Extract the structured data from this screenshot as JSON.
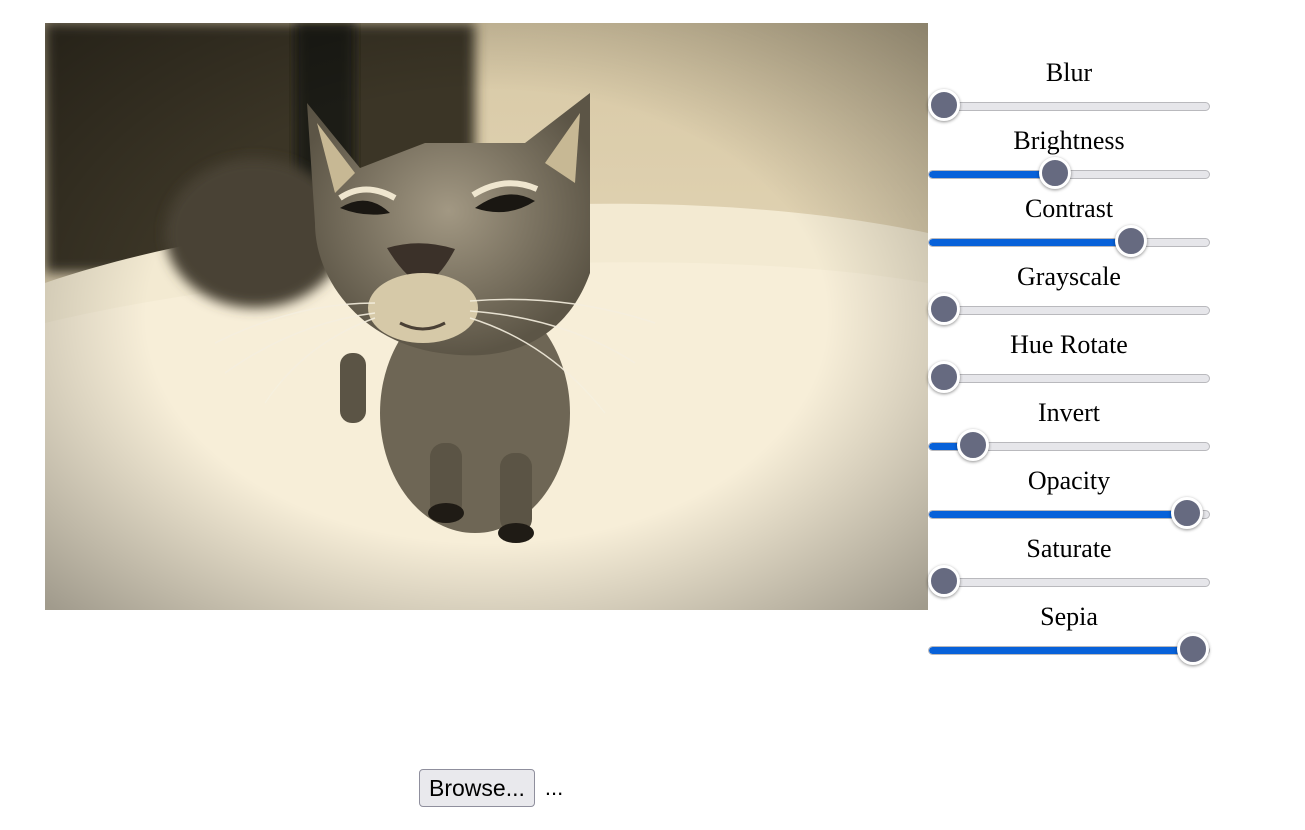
{
  "preview": {
    "image": "sepia-toned-cat-photo"
  },
  "filters": [
    {
      "label": "Blur",
      "value": 0.05
    },
    {
      "label": "Brightness",
      "value": 0.45
    },
    {
      "label": "Contrast",
      "value": 0.72
    },
    {
      "label": "Grayscale",
      "value": 0.05
    },
    {
      "label": "Hue Rotate",
      "value": 0.05
    },
    {
      "label": "Invert",
      "value": 0.16
    },
    {
      "label": "Opacity",
      "value": 0.92
    },
    {
      "label": "Saturate",
      "value": 0.05
    },
    {
      "label": "Sepia",
      "value": 0.94
    }
  ],
  "colors": {
    "accent": "#0761d9",
    "thumb": "#666a80",
    "track": "#e6e6ea"
  },
  "file": {
    "button_label": "Browse...",
    "status": "..."
  }
}
